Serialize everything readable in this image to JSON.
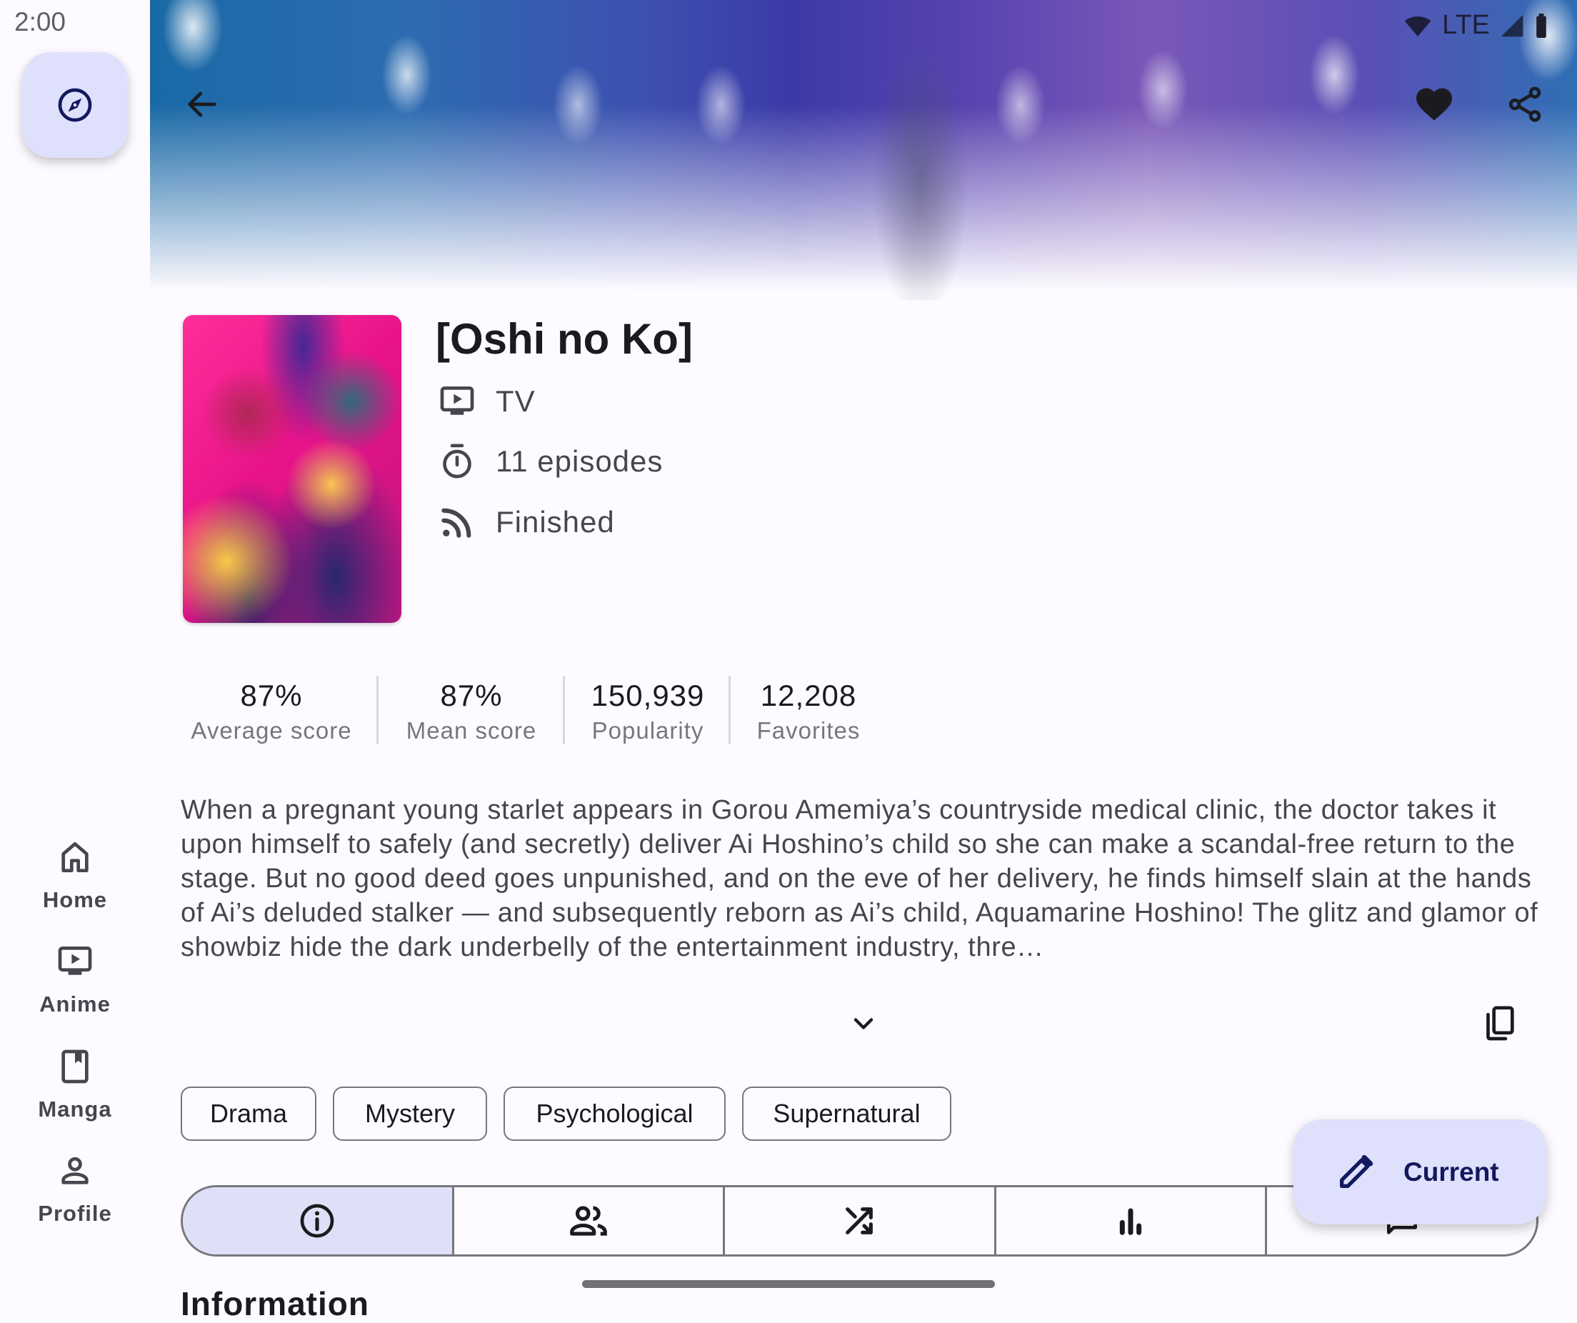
{
  "status_bar": {
    "time": "2:00",
    "network": "LTE"
  },
  "nav_rail": {
    "fab_icon": "explore-icon",
    "items": [
      {
        "label": "Home",
        "icon": "home-icon"
      },
      {
        "label": "Anime",
        "icon": "tv-icon"
      },
      {
        "label": "Manga",
        "icon": "book-icon"
      },
      {
        "label": "Profile",
        "icon": "person-icon"
      }
    ]
  },
  "top_bar": {
    "back_icon": "arrow-back-icon",
    "favorite_icon": "heart-filled-icon",
    "share_icon": "share-icon"
  },
  "media": {
    "title": "[Oshi no Ko]",
    "format": "TV",
    "episodes": "11 episodes",
    "status": "Finished"
  },
  "stats": [
    {
      "value": "87%",
      "label": "Average score"
    },
    {
      "value": "87%",
      "label": "Mean score"
    },
    {
      "value": "150,939",
      "label": "Popularity"
    },
    {
      "value": "12,208",
      "label": "Favorites"
    }
  ],
  "description": "When a pregnant young starlet appears in Gorou Amemiya’s countryside medical clinic, the doctor takes it upon himself to safely (and secretly) deliver Ai Hoshino’s child so she can make a scandal-free return to the stage. But no good deed goes unpunished, and on the eve of her delivery, he finds himself slain at the hands of Ai’s deluded stalker — and subsequently reborn as Ai’s child, Aquamarine Hoshino! The glitz and glamor of showbiz hide the dark underbelly of the entertainment industry, thre…",
  "genres": [
    "Drama",
    "Mystery",
    "Psychological",
    "Supernatural"
  ],
  "tabs": [
    {
      "icon": "info-icon",
      "selected": true
    },
    {
      "icon": "people-icon",
      "selected": false
    },
    {
      "icon": "shuffle-icon",
      "selected": false
    },
    {
      "icon": "bar-chart-icon",
      "selected": false
    },
    {
      "icon": "comment-icon",
      "selected": false
    }
  ],
  "fab": {
    "label": "Current",
    "icon": "edit-icon"
  },
  "section_heading": "Information",
  "colors": {
    "accent_container": "#dfe0fb",
    "on_accent": "#12195e",
    "outline": "#76767f",
    "background": "#fdfbff"
  }
}
